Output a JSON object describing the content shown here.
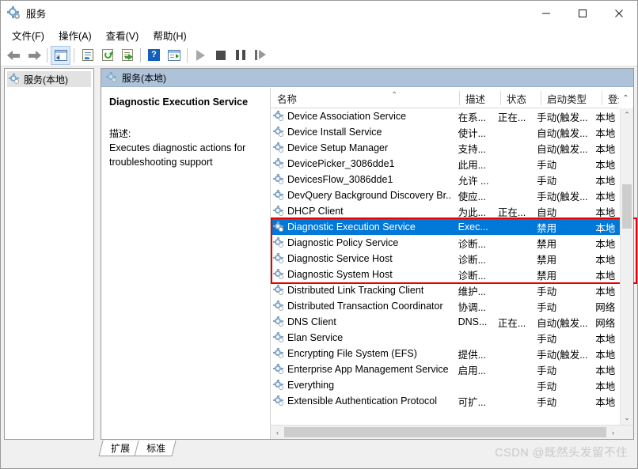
{
  "window": {
    "title": "服务",
    "icon": "services-gear-icon",
    "minimize": "−",
    "maximize": "□",
    "close": "✕"
  },
  "menu": {
    "items": [
      {
        "label": "文件(F)",
        "name": "menu-file"
      },
      {
        "label": "操作(A)",
        "name": "menu-action"
      },
      {
        "label": "查看(V)",
        "name": "menu-view"
      },
      {
        "label": "帮助(H)",
        "name": "menu-help"
      }
    ]
  },
  "toolbar": {
    "buttons": [
      {
        "name": "back-arrow-icon",
        "label": "后退"
      },
      {
        "name": "forward-arrow-icon",
        "label": "前进"
      },
      {
        "name": "show-hide-tree-icon",
        "label": "显示/隐藏控制台树"
      },
      {
        "name": "properties-icon",
        "label": "属性"
      },
      {
        "name": "refresh-icon",
        "label": "刷新"
      },
      {
        "name": "export-list-icon",
        "label": "导出列表"
      },
      {
        "name": "help-icon",
        "label": "帮助"
      },
      {
        "name": "show-console-icon",
        "label": "显示操作窗格"
      },
      {
        "name": "start-service-icon",
        "label": "启动服务"
      },
      {
        "name": "stop-service-icon",
        "label": "停止服务"
      },
      {
        "name": "pause-service-icon",
        "label": "暂停服务"
      },
      {
        "name": "restart-service-icon",
        "label": "重启服务"
      }
    ]
  },
  "tree": {
    "root_label": "服务(本地)",
    "root_icon": "services-gear-icon"
  },
  "right_pane": {
    "header_label": "服务(本地)",
    "header_icon": "services-gear-icon"
  },
  "details": {
    "service_name": "Diagnostic Execution Service",
    "description_label": "描述:",
    "description_text": "Executes diagnostic actions for troubleshooting support"
  },
  "list": {
    "columns": [
      {
        "key": "name",
        "label": "名称"
      },
      {
        "key": "desc",
        "label": "描述"
      },
      {
        "key": "stat",
        "label": "状态"
      },
      {
        "key": "start",
        "label": "启动类型"
      },
      {
        "key": "logon",
        "label": "登录"
      }
    ],
    "sort_indicator": "⌃",
    "header_overflow_chevron": "⌃",
    "rows": [
      {
        "name": "Device Association Service",
        "desc": "在系...",
        "stat": "正在...",
        "start": "手动(触发...",
        "logon": "本地",
        "selected": false,
        "highlighted": false
      },
      {
        "name": "Device Install Service",
        "desc": "使计...",
        "stat": "",
        "start": "自动(触发...",
        "logon": "本地",
        "selected": false,
        "highlighted": false
      },
      {
        "name": "Device Setup Manager",
        "desc": "支持...",
        "stat": "",
        "start": "自动(触发...",
        "logon": "本地",
        "selected": false,
        "highlighted": false
      },
      {
        "name": "DevicePicker_3086dde1",
        "desc": "此用...",
        "stat": "",
        "start": "手动",
        "logon": "本地",
        "selected": false,
        "highlighted": false
      },
      {
        "name": "DevicesFlow_3086dde1",
        "desc": "允许 ...",
        "stat": "",
        "start": "手动",
        "logon": "本地",
        "selected": false,
        "highlighted": false
      },
      {
        "name": "DevQuery Background Discovery Br...",
        "desc": "使应...",
        "stat": "",
        "start": "手动(触发...",
        "logon": "本地",
        "selected": false,
        "highlighted": false
      },
      {
        "name": "DHCP Client",
        "desc": "为此...",
        "stat": "正在...",
        "start": "自动",
        "logon": "本地",
        "selected": false,
        "highlighted": false
      },
      {
        "name": "Diagnostic Execution Service",
        "desc": "Exec...",
        "stat": "",
        "start": "禁用",
        "logon": "本地",
        "selected": true,
        "highlighted": true
      },
      {
        "name": "Diagnostic Policy Service",
        "desc": "诊断...",
        "stat": "",
        "start": "禁用",
        "logon": "本地",
        "selected": false,
        "highlighted": true
      },
      {
        "name": "Diagnostic Service Host",
        "desc": "诊断...",
        "stat": "",
        "start": "禁用",
        "logon": "本地",
        "selected": false,
        "highlighted": true
      },
      {
        "name": "Diagnostic System Host",
        "desc": "诊断...",
        "stat": "",
        "start": "禁用",
        "logon": "本地",
        "selected": false,
        "highlighted": true
      },
      {
        "name": "Distributed Link Tracking Client",
        "desc": "维护...",
        "stat": "",
        "start": "手动",
        "logon": "本地",
        "selected": false,
        "highlighted": false
      },
      {
        "name": "Distributed Transaction Coordinator",
        "desc": "协调...",
        "stat": "",
        "start": "手动",
        "logon": "网络",
        "selected": false,
        "highlighted": false
      },
      {
        "name": "DNS Client",
        "desc": "DNS...",
        "stat": "正在...",
        "start": "自动(触发...",
        "logon": "网络",
        "selected": false,
        "highlighted": false
      },
      {
        "name": "Elan Service",
        "desc": "",
        "stat": "",
        "start": "手动",
        "logon": "本地",
        "selected": false,
        "highlighted": false
      },
      {
        "name": "Encrypting File System (EFS)",
        "desc": "提供...",
        "stat": "",
        "start": "手动(触发...",
        "logon": "本地",
        "selected": false,
        "highlighted": false
      },
      {
        "name": "Enterprise App Management Service",
        "desc": "启用...",
        "stat": "",
        "start": "手动",
        "logon": "本地",
        "selected": false,
        "highlighted": false
      },
      {
        "name": "Everything",
        "desc": "",
        "stat": "",
        "start": "手动",
        "logon": "本地",
        "selected": false,
        "highlighted": false
      },
      {
        "name": "Extensible Authentication Protocol",
        "desc": "可扩...",
        "stat": "",
        "start": "手动",
        "logon": "本地",
        "selected": false,
        "highlighted": false
      }
    ],
    "scroll": {
      "up_arrow": "⌃",
      "down_arrow": "⌄",
      "left_arrow": "‹",
      "right_arrow": "›"
    }
  },
  "tabs": [
    {
      "label": "扩展",
      "name": "tab-extended",
      "active": false
    },
    {
      "label": "标准",
      "name": "tab-standard",
      "active": true
    }
  ],
  "watermark": "CSDN @既然头发留不住",
  "colors": {
    "selection": "#0078d7",
    "annotation_box": "#e60000",
    "pane_header": "#aec3da",
    "window_bg": "#f0f0f0"
  }
}
